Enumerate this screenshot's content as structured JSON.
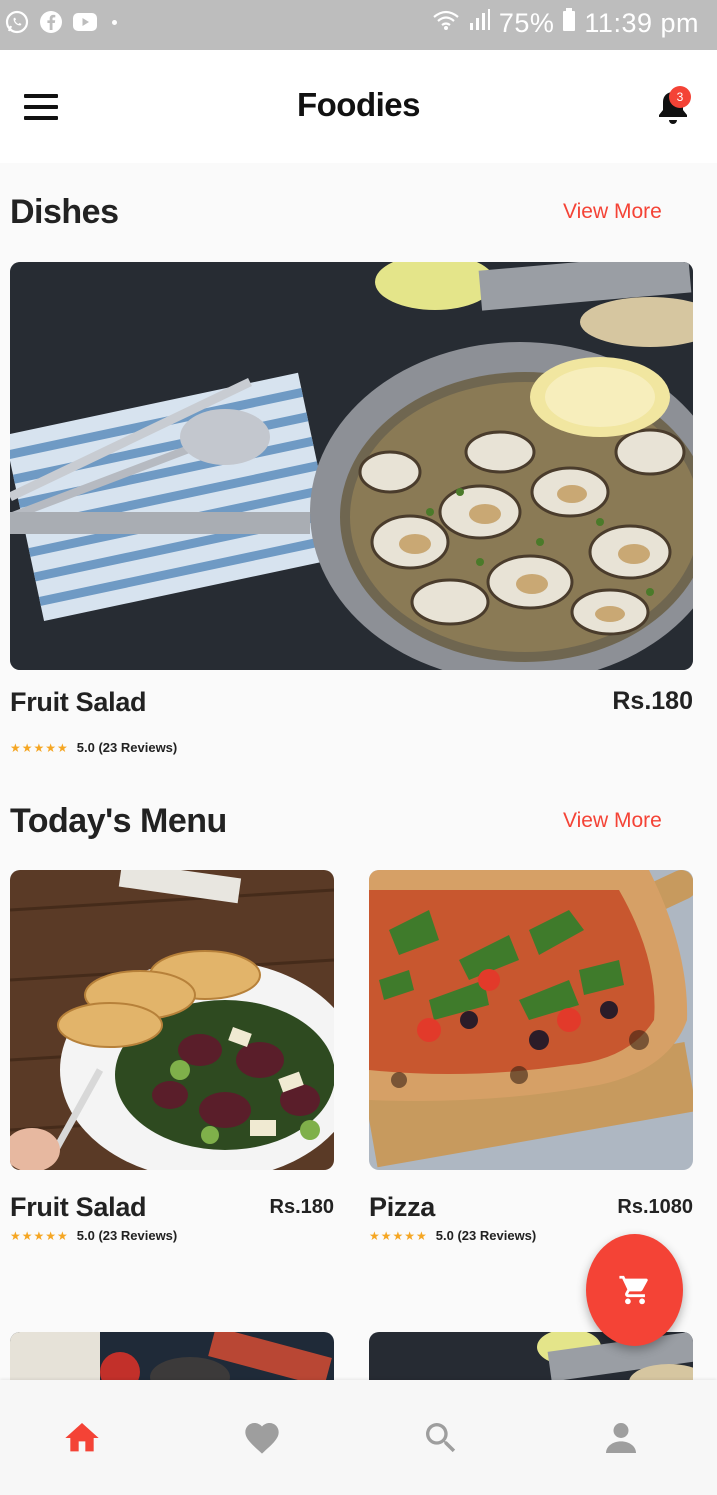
{
  "status_bar": {
    "battery": "75%",
    "time": "11:39 pm",
    "icons": [
      "whatsapp-icon",
      "facebook-icon",
      "youtube-icon",
      "wifi-icon",
      "signal-icon",
      "battery-icon"
    ]
  },
  "app_bar": {
    "title": "Foodies",
    "notification_count": "3"
  },
  "dishes": {
    "title": "Dishes",
    "view_more": "View More",
    "featured": {
      "name": "Fruit Salad",
      "price": "Rs.180",
      "rating": "5.0 (23 Reviews)",
      "stars": "★★★★★"
    }
  },
  "todays_menu": {
    "title": "Today's Menu",
    "view_more": "View More",
    "items": [
      {
        "name": "Fruit Salad",
        "price": "Rs.180",
        "rating": "5.0 (23 Reviews)",
        "stars": "★★★★★"
      },
      {
        "name": "Pizza",
        "price": "Rs.1080",
        "rating": "5.0 (23 Reviews)",
        "stars": "★★★★★"
      }
    ]
  },
  "colors": {
    "accent": "#f44336",
    "star": "#f5a623",
    "nav_inactive": "#9e9e9e"
  },
  "bottom_nav": {
    "items": [
      "home-icon",
      "heart-icon",
      "search-icon",
      "profile-icon"
    ],
    "active": "home-icon"
  }
}
